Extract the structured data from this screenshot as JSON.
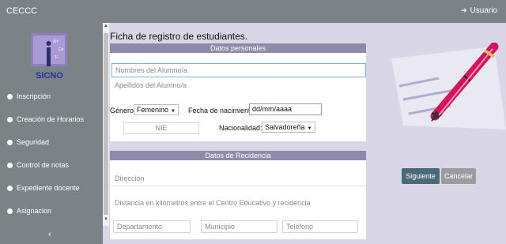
{
  "topbar": {
    "brand": "CECCC",
    "user_label": "Usuario",
    "user_icon": "sign-in-icon"
  },
  "sidebar": {
    "logo_text": "SICNO",
    "logo_letters": [
      "A+",
      "Co",
      "F-"
    ],
    "items": [
      {
        "label": "Inscripción"
      },
      {
        "label": "Creación de Horarios"
      },
      {
        "label": "Seguridad"
      },
      {
        "label": "Control de notas"
      },
      {
        "label": "Expediente docente"
      },
      {
        "label": "Asignacion"
      }
    ],
    "collapse_icon": "‹"
  },
  "form": {
    "title": "Ficha de registro de estudiantes.",
    "personal": {
      "header": "Datos personales",
      "nombres_placeholder": "Nombres del Alumno/a",
      "apellidos_placeholder": "Apellidos del Alumno/a",
      "genero_label": "Género :",
      "genero_value": "Femenino",
      "fecha_label": "Fecha de nacimiento",
      "fecha_value": "dd/mm/aaaa",
      "nie_placeholder": "NIE",
      "nacionalidad_label": "Nacionalidad:",
      "nacionalidad_value": "Salvadoreña"
    },
    "residencia": {
      "header": "Datos de Recidencia",
      "direccion_placeholder": "Dirección",
      "distancia_placeholder": "Distancia en kilómetros entre el Centro Educativo y recidencia",
      "departamento_placeholder": "Departamento",
      "municipio_placeholder": "Municipio",
      "telefono_placeholder": "Teléfono"
    }
  },
  "actions": {
    "next": "Siguiente",
    "cancel": "Cancelar"
  },
  "colors": {
    "sidebar": "#7c8386",
    "section_header": "#8e8aa9",
    "background": "#d9d6e6",
    "pen": "#d4145a"
  }
}
